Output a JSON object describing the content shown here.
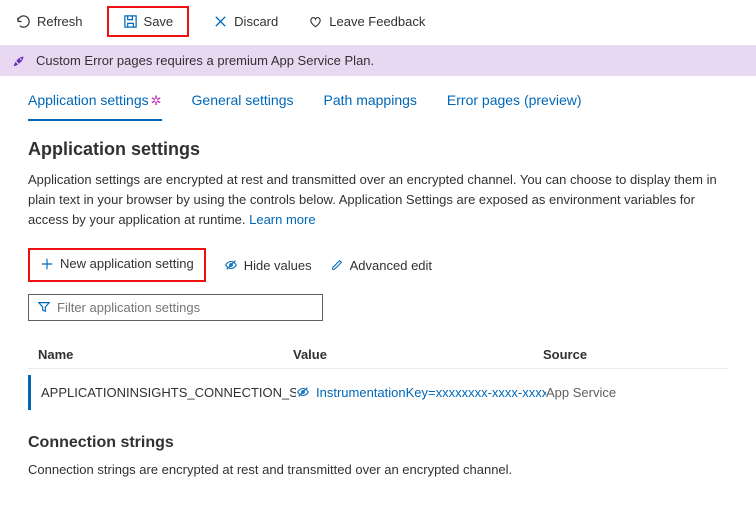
{
  "toolbar": {
    "refresh": "Refresh",
    "save": "Save",
    "discard": "Discard",
    "feedback": "Leave Feedback"
  },
  "banner": {
    "text": "Custom Error pages requires a premium App Service Plan."
  },
  "tabs": {
    "app_settings": "Application settings",
    "general": "General settings",
    "path": "Path mappings",
    "errors": "Error pages (preview)"
  },
  "app_settings": {
    "heading": "Application settings",
    "desc": "Application settings are encrypted at rest and transmitted over an encrypted channel. You can choose to display them in plain text in your browser by using the controls below. Application Settings are exposed as environment variables for access by your application at runtime. ",
    "learn_more": "Learn more",
    "actions": {
      "new": "New application setting",
      "hide": "Hide values",
      "advanced": "Advanced edit"
    },
    "filter_placeholder": "Filter application settings",
    "columns": {
      "name": "Name",
      "value": "Value",
      "source": "Source"
    },
    "rows": [
      {
        "name": "APPLICATIONINSIGHTS_CONNECTION_STRING",
        "value": "InstrumentationKey=xxxxxxxx-xxxx-xxxx",
        "source": "App Service"
      }
    ]
  },
  "connection": {
    "heading": "Connection strings",
    "desc": "Connection strings are encrypted at rest and transmitted over an encrypted channel."
  }
}
